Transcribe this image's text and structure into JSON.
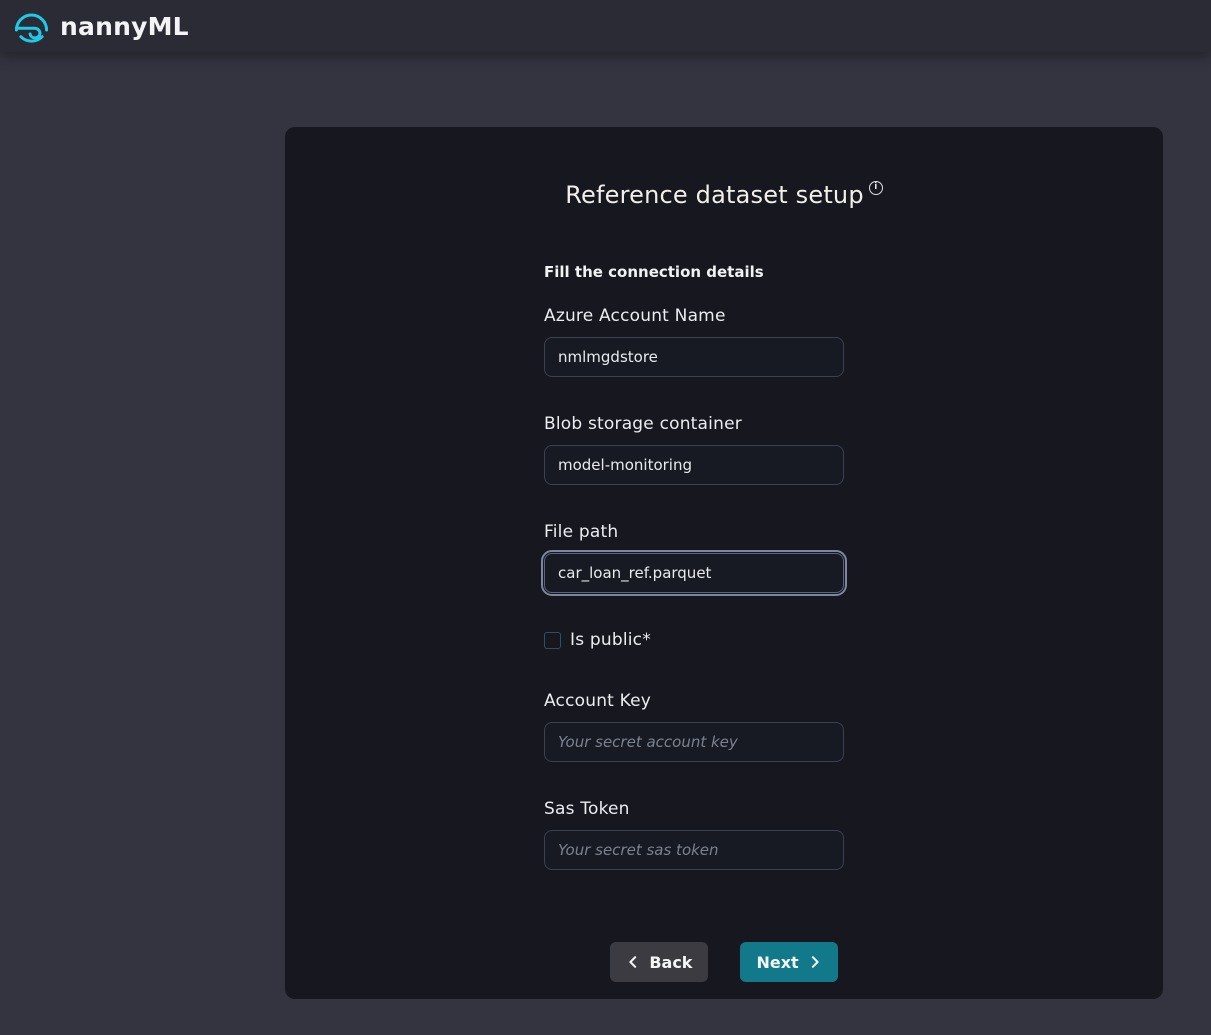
{
  "colors": {
    "brand_cyan": "#1fc9e7",
    "accent_teal": "#12798a",
    "page_bg": "#33343f",
    "header_bg": "#2a2b35",
    "card_bg": "#16171f",
    "back_button_bg": "#3b3b41"
  },
  "header": {
    "brand_first": "nanny",
    "brand_second": "ML"
  },
  "icons": {
    "logo": "nannyml-mark",
    "title_info": "info-circle",
    "info_glyph": "i",
    "back": "chevron-left",
    "next": "chevron-right"
  },
  "dialog": {
    "title": "Reference dataset setup",
    "section_heading": "Fill the connection details",
    "fields": [
      {
        "label": "Azure Account Name",
        "value": "nmlmgdstore",
        "placeholder": ""
      },
      {
        "label": "Blob storage container",
        "value": "model-monitoring",
        "placeholder": ""
      },
      {
        "label": "File path",
        "value": "car_loan_ref.parquet",
        "placeholder": ""
      },
      {
        "label": "Account Key",
        "value": "",
        "placeholder": "Your secret account key"
      },
      {
        "label": "Sas Token",
        "value": "",
        "placeholder": "Your secret sas token"
      }
    ],
    "checkbox": {
      "label": "Is public*",
      "checked": false
    },
    "buttons": {
      "back_label": "Back",
      "next_label": "Next"
    }
  }
}
